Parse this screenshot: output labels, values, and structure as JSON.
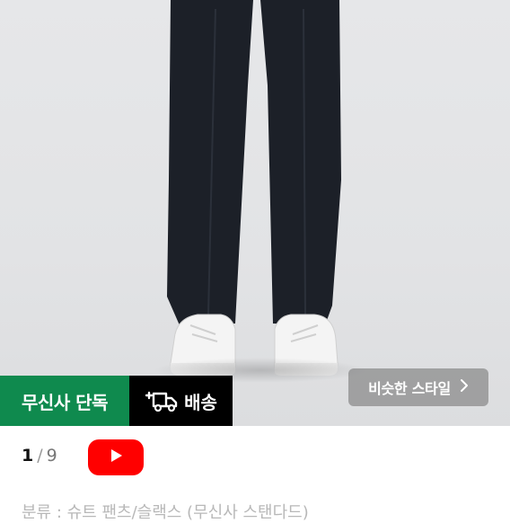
{
  "badges": {
    "exclusive_label": "무신사 단독",
    "delivery_label": "배송",
    "delivery_icon": "fast-delivery-truck-icon"
  },
  "similar_style": {
    "label": "비슷한 스타일",
    "icon": "chevron-right-icon"
  },
  "gallery": {
    "current": "1",
    "separator": "/",
    "total": "9"
  },
  "video_button": {
    "icon": "youtube-play-icon",
    "color": "#ff0000"
  },
  "category_text": "분류 : 슈트 팬츠/슬랙스 (무신사 스탠다드)",
  "colors": {
    "exclusive": "#0f8a4e",
    "delivery": "#000000",
    "accent": "#ff0000"
  }
}
